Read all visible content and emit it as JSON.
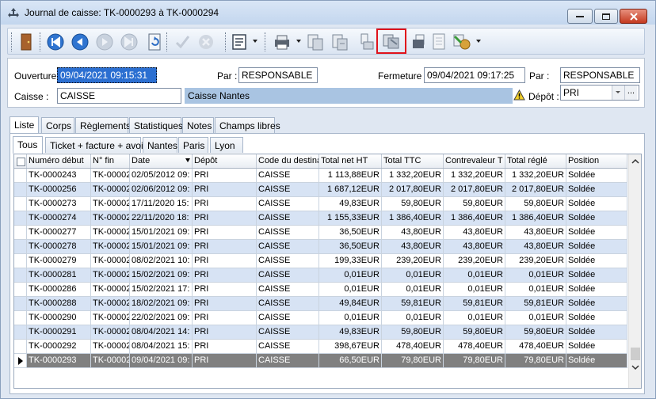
{
  "window": {
    "title": "Journal de caisse: TK-0000293 à TK-0000294"
  },
  "toolbar": {
    "icons": [
      "door-icon",
      "first-icon",
      "previous-icon",
      "next-icon",
      "last-icon",
      "refresh-icon",
      "validate-icon",
      "cancel-icon",
      "report-icon",
      "print-icon",
      "doc-chain-icon",
      "doc-chain2-icon",
      "pos-icon",
      "transfer-icon",
      "copy-icon",
      "page-icon",
      "export-icon"
    ]
  },
  "header": {
    "ouverture_label": "Ouverture :",
    "ouverture_value": "09/04/2021 09:15:31",
    "par1_label": "Par :",
    "par1_value": "RESPONSABLE",
    "fermeture_label": "Fermeture :",
    "fermeture_value": "09/04/2021 09:17:25",
    "par2_label": "Par :",
    "par2_value": "RESPONSABLE",
    "caisse_label": "Caisse :",
    "caisse_code": "CAISSE",
    "caisse_name": "Caisse Nantes",
    "depot_label": "Dépôt :",
    "depot_value": "PRI",
    "depot_more": "..."
  },
  "tabs_main": [
    "Liste",
    "Corps",
    "Règlements",
    "Statistiques",
    "Notes",
    "Champs libres"
  ],
  "tabs_sub": [
    "Tous",
    "Ticket + facture + avoir",
    "Nantes",
    "Paris",
    "Lyon"
  ],
  "grid": {
    "columns": [
      "Numéro début",
      "N° fin",
      "Date",
      "Dépôt",
      "Code du destina",
      "Total net HT",
      "Total TTC",
      "Contrevaleur T",
      "Total réglé",
      "Position"
    ],
    "rows": [
      [
        "TK-0000243",
        "TK-00002",
        "02/05/2012 09:",
        "PRI",
        "CAISSE",
        "1 113,88EUR",
        "1 332,20EUR",
        "1 332,20EUR",
        "1 332,20EUR",
        "Soldée"
      ],
      [
        "TK-0000256",
        "TK-00002",
        "02/06/2012 09:",
        "PRI",
        "CAISSE",
        "1 687,12EUR",
        "2 017,80EUR",
        "2 017,80EUR",
        "2 017,80EUR",
        "Soldée"
      ],
      [
        "TK-0000273",
        "TK-00002",
        "17/11/2020 15:",
        "PRI",
        "CAISSE",
        "49,83EUR",
        "59,80EUR",
        "59,80EUR",
        "59,80EUR",
        "Soldée"
      ],
      [
        "TK-0000274",
        "TK-00002",
        "22/11/2020 18:",
        "PRI",
        "CAISSE",
        "1 155,33EUR",
        "1 386,40EUR",
        "1 386,40EUR",
        "1 386,40EUR",
        "Soldée"
      ],
      [
        "TK-0000277",
        "TK-00002",
        "15/01/2021 09:",
        "PRI",
        "CAISSE",
        "36,50EUR",
        "43,80EUR",
        "43,80EUR",
        "43,80EUR",
        "Soldée"
      ],
      [
        "TK-0000278",
        "TK-00002",
        "15/01/2021 09:",
        "PRI",
        "CAISSE",
        "36,50EUR",
        "43,80EUR",
        "43,80EUR",
        "43,80EUR",
        "Soldée"
      ],
      [
        "TK-0000279",
        "TK-00002",
        "08/02/2021 10:",
        "PRI",
        "CAISSE",
        "199,33EUR",
        "239,20EUR",
        "239,20EUR",
        "239,20EUR",
        "Soldée"
      ],
      [
        "TK-0000281",
        "TK-00002",
        "15/02/2021 09:",
        "PRI",
        "CAISSE",
        "0,01EUR",
        "0,01EUR",
        "0,01EUR",
        "0,01EUR",
        "Soldée"
      ],
      [
        "TK-0000286",
        "TK-00002",
        "15/02/2021 17:",
        "PRI",
        "CAISSE",
        "0,01EUR",
        "0,01EUR",
        "0,01EUR",
        "0,01EUR",
        "Soldée"
      ],
      [
        "TK-0000288",
        "TK-00002",
        "18/02/2021 09:",
        "PRI",
        "CAISSE",
        "49,84EUR",
        "59,81EUR",
        "59,81EUR",
        "59,81EUR",
        "Soldée"
      ],
      [
        "TK-0000290",
        "TK-00002",
        "22/02/2021 09:",
        "PRI",
        "CAISSE",
        "0,01EUR",
        "0,01EUR",
        "0,01EUR",
        "0,01EUR",
        "Soldée"
      ],
      [
        "TK-0000291",
        "TK-00002",
        "08/04/2021 14:",
        "PRI",
        "CAISSE",
        "49,83EUR",
        "59,80EUR",
        "59,80EUR",
        "59,80EUR",
        "Soldée"
      ],
      [
        "TK-0000292",
        "TK-00002",
        "08/04/2021 15:",
        "PRI",
        "CAISSE",
        "398,67EUR",
        "478,40EUR",
        "478,40EUR",
        "478,40EUR",
        "Soldée"
      ],
      [
        "TK-0000293",
        "TK-00002",
        "09/04/2021 09:",
        "PRI",
        "CAISSE",
        "66,50EUR",
        "79,80EUR",
        "79,80EUR",
        "79,80EUR",
        "Soldée"
      ]
    ],
    "selected_row": 13
  }
}
